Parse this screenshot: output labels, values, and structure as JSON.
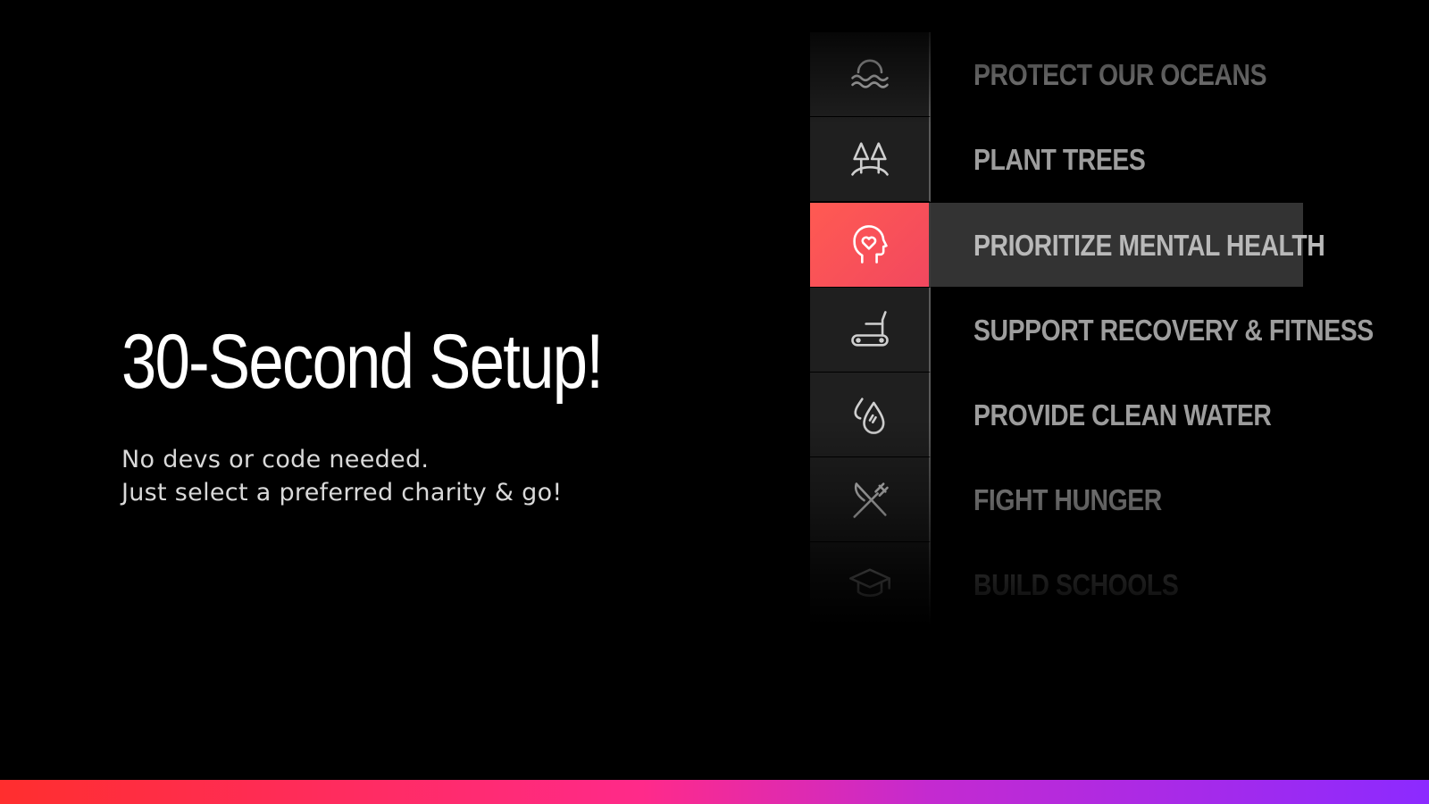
{
  "hero": {
    "title": "30-Second Setup!",
    "subtitle_lines": [
      "No devs or code needed.",
      "Just select a preferred charity & go!"
    ]
  },
  "charities": [
    {
      "label": "PROTECT OUR OCEANS",
      "icon": "ocean-icon",
      "selected": false
    },
    {
      "label": "PLANT TREES",
      "icon": "trees-icon",
      "selected": false
    },
    {
      "label": "PRIORITIZE MENTAL HEALTH",
      "icon": "mental-health-icon",
      "selected": true
    },
    {
      "label": "SUPPORT RECOVERY & FITNESS",
      "icon": "treadmill-icon",
      "selected": false
    },
    {
      "label": "PROVIDE CLEAN WATER",
      "icon": "water-drops-icon",
      "selected": false
    },
    {
      "label": "FIGHT HUNGER",
      "icon": "utensils-icon",
      "selected": false
    },
    {
      "label": "BUILD SCHOOLS",
      "icon": "graduation-cap-icon",
      "selected": false
    }
  ],
  "colors": {
    "selected_accent": "#f74f58",
    "bar_gradient": [
      "#ff2e2e",
      "#ff2a8a",
      "#8c2aff"
    ]
  }
}
